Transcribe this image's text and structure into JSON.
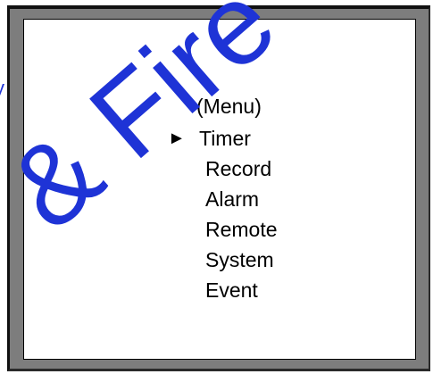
{
  "watermark": {
    "text": "& Fire",
    "fragment": "y",
    "color": "#1e33d6"
  },
  "menu": {
    "title": "(Menu)",
    "cursor_icon": "triangle-right-icon",
    "selected_index": 0,
    "items": [
      {
        "label": "Timer"
      },
      {
        "label": "Record"
      },
      {
        "label": "Alarm"
      },
      {
        "label": "Remote"
      },
      {
        "label": "System"
      },
      {
        "label": "Event"
      }
    ]
  }
}
